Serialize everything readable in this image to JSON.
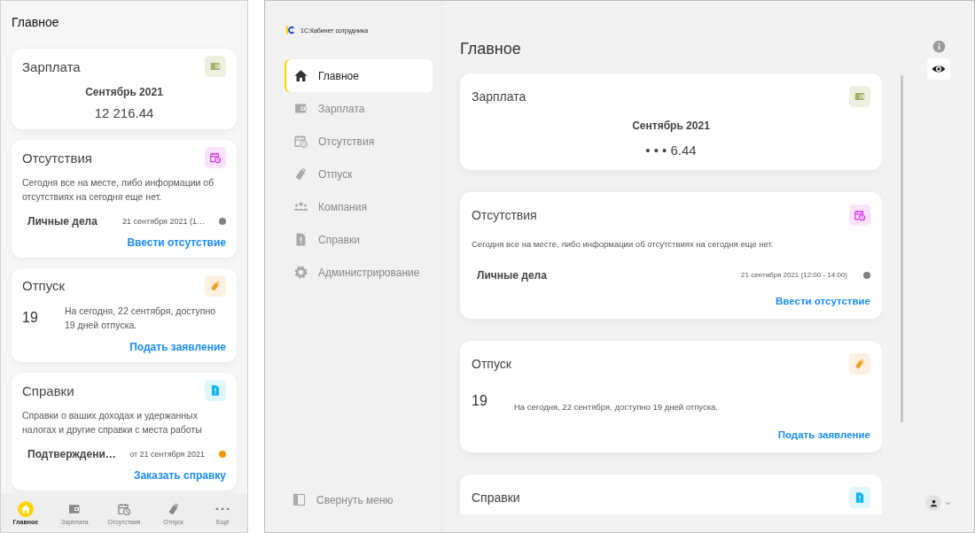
{
  "mobile": {
    "title": "Главное",
    "cards": [
      {
        "kind": "salary",
        "title": "Зарплата",
        "period": "Сентябрь 2021",
        "amount": "12 216.44"
      },
      {
        "kind": "absence",
        "title": "Отсутствия",
        "text": "Сегодня все на месте, либо информации об отсутствиях на сегодня еще нет.",
        "item": {
          "name": "Личные дела",
          "date": "21 сентября 2021 (1…",
          "color": "#808080"
        },
        "action": "Ввести отсутствие"
      },
      {
        "kind": "vacation",
        "title": "Отпуск",
        "days": "19",
        "text": "На сегодня, 22 сентября, доступно 19 дней отпуска.",
        "action": "Подать заявление"
      },
      {
        "kind": "certificates",
        "title": "Справки",
        "text": "Справки о ваших доходах и удержанных налогах и другие справки с места работы",
        "item": {
          "name": "Подтверждени…",
          "date": "от 21 сентября 2021",
          "color": "#f59a00"
        },
        "action": "Заказать справку"
      }
    ],
    "bottom_nav": [
      {
        "kind": "home",
        "label": "Главное",
        "selected": true
      },
      {
        "kind": "wallet",
        "label": "Зарплата",
        "selected": false
      },
      {
        "kind": "calendar",
        "label": "Отсутствия",
        "selected": false
      },
      {
        "kind": "suitcase",
        "label": "Отпуск",
        "selected": false
      },
      {
        "kind": "dots",
        "label": "Ещё",
        "selected": false
      }
    ]
  },
  "desktop": {
    "logo": "1С:Кабинет сотрудника",
    "nav": [
      {
        "kind": "home",
        "label": "Главное",
        "selected": true
      },
      {
        "kind": "wallet",
        "label": "Зарплата",
        "selected": false
      },
      {
        "kind": "calendar",
        "label": "Отсутствия",
        "selected": false
      },
      {
        "kind": "suitcase",
        "label": "Отпуск",
        "selected": false
      },
      {
        "kind": "people",
        "label": "Компания",
        "selected": false
      },
      {
        "kind": "document",
        "label": "Справки",
        "selected": false
      },
      {
        "kind": "gear",
        "label": "Администрирование",
        "selected": false
      }
    ],
    "collapse": "Свернуть меню",
    "title": "Главное",
    "cards": [
      {
        "kind": "salary",
        "title": "Зарплата",
        "period": "Сентябрь 2021",
        "amount": "• • • 6.44"
      },
      {
        "kind": "absence",
        "title": "Отсутствия",
        "text": "Сегодня все на месте, либо информации об отсутствиях на сегодня еще нет.",
        "item": {
          "name": "Личные дела",
          "date": "21 сентября 2021 (12:00 - 14:00)",
          "color": "#808080"
        },
        "action": "Ввести отсутствие"
      },
      {
        "kind": "vacation",
        "title": "Отпуск",
        "days": "19",
        "text": "На сегодня, 22 сентября, доступно 19 дней отпуска.",
        "action": "Подать заявление"
      },
      {
        "kind": "certificates",
        "title": "Справки"
      }
    ]
  }
}
